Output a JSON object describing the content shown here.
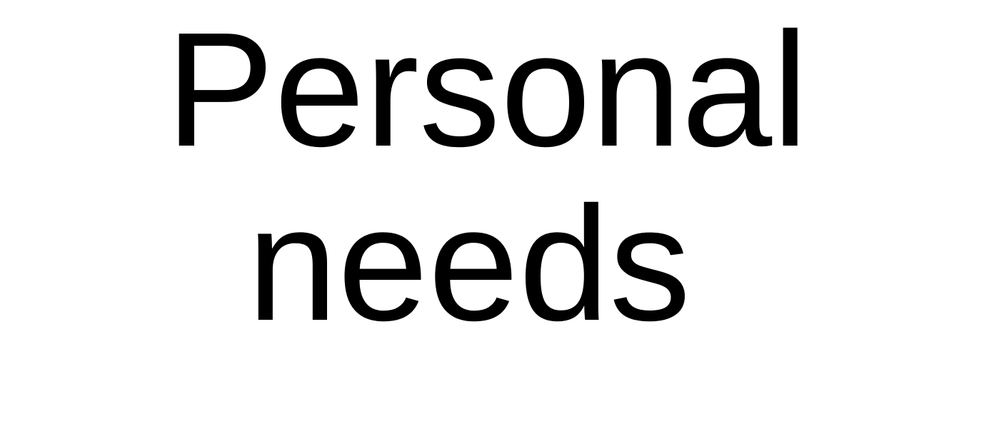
{
  "lines": [
    "Personal",
    "needs"
  ],
  "colors": {
    "text": "#000000",
    "background": "#ffffff"
  }
}
